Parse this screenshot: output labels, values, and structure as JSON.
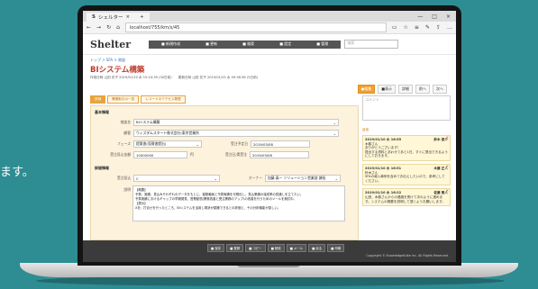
{
  "background_text": "ます。",
  "browser": {
    "tab_title": "シェルター",
    "url": "localhost/755/km/s/45",
    "nav_back": "←",
    "nav_forward": "→",
    "reload": "↻",
    "home": "⌂",
    "new_tab": "+",
    "win_min": "—",
    "win_max": "□",
    "win_close": "×"
  },
  "app": {
    "logo": "Shelter",
    "nav": [
      "■ 新規作成",
      "■ 更新",
      "■ 検索",
      "■ 設定",
      "■ 管理"
    ],
    "search_placeholder": "検索"
  },
  "page": {
    "breadcrumb": "トップ > SFA > 商談",
    "title": "BIシステム構築",
    "meta": "作成日時 山田 花子 2019/01/10 水 15:24:39 (30日前)　　更新日時 山田 花子 2019/01/25 水 09:36:36 (5日前)",
    "actions": [
      "●編集",
      "■表示",
      "詳細",
      "前へ",
      "次へ"
    ]
  },
  "subtabs": [
    "詳細",
    "関連取引の一覧",
    "レコードのアクセス履歴"
  ],
  "form": {
    "section_basic": "基本情報",
    "section_detail": "詳細情報",
    "fields": {
      "name_label": "商談名",
      "name_value": "BIシステム構築",
      "client_label": "顧客",
      "client_value": "ウィズダムスタート株式会社(東京営業所",
      "phase_label": "フェーズ",
      "phase_value": "提案書(見積書提出)",
      "close_label": "受注予定日",
      "close_value": "2019/03/08",
      "amount_label": "受注見込金額",
      "amount_value": "10000000",
      "amount_unit": "円",
      "forecast_label": "受注日/実受注",
      "forecast_value": "2019/03/08",
      "rank_label": "受注見込",
      "rank_value": "C",
      "owner_label": "オーナー",
      "owner_value": "加藤 真一 ソリューション営業部 課長",
      "desc_label": "説明",
      "desc_text": "【概要】\n予算、実績、見込みそれぞれのデータをもとに、複数軸後と予算実績を可視化し、見込業績の達成率の見通しを立てたい。\n予算実績におけるギャップの早期発見、営業動態(業務改善と受注業務のアップ)の改善を行うためのツールを検討中。\n【提示】\nX社：打合せを行ったところ、BIシステムを活用し現状が認識できるとの評価と、その分析機能が欲しい。"
    }
  },
  "buttons": [
    "■ 保存",
    "■ 登録",
    "■ コピー",
    "■ 削除",
    "■ メール",
    "■ 戻る",
    "■ 印刷"
  ],
  "copyright": "Copyright © KnowledgeSuite Inc. All Rights Reserved.",
  "comments": {
    "input_placeholder": "コメント",
    "list_label": "返信",
    "items": [
      {
        "date": "2019/01/10 水 16:55",
        "author": "鈴木 俊介",
        "body": "木藤さん\nありがとうございます！\n提出する資料とあわせてあと1日、すぐに提出できるようにしておきます。"
      },
      {
        "date": "2019/01/10 水 16:51",
        "author": "木藤 正人",
        "body": "鈴木さん\nSFAの導入事例を含めてお伝えしたいので、参考にしてください。"
      },
      {
        "date": "2019/01/10 水 16:22",
        "author": "佐藤 雅人",
        "body": "山田、木藤さんからの連絡を受けて次のように進めます。システムの概要を説明して頂くようお願いします。"
      }
    ]
  }
}
